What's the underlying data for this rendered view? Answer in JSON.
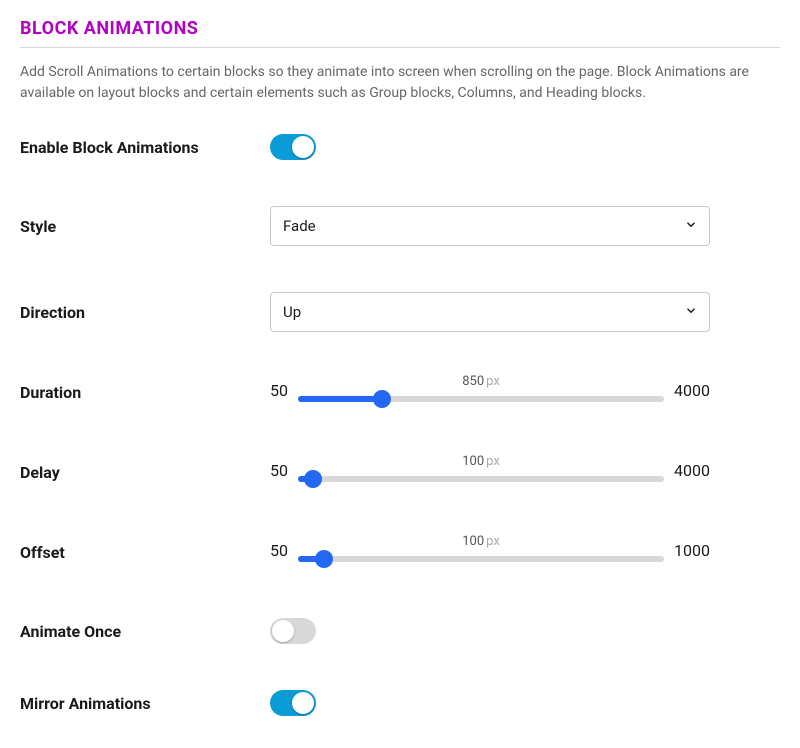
{
  "section": {
    "title": "BLOCK ANIMATIONS",
    "description": "Add Scroll Animations to certain blocks so they animate into screen when scrolling on the page. Block Animations are available on layout blocks and certain elements such as Group blocks, Columns, and Heading blocks."
  },
  "fields": {
    "enable": {
      "label": "Enable Block Animations",
      "value": true
    },
    "style": {
      "label": "Style",
      "value": "Fade"
    },
    "direction": {
      "label": "Direction",
      "value": "Up"
    },
    "duration": {
      "label": "Duration",
      "min": "50",
      "max": "4000",
      "value": "850",
      "unit": "px",
      "percent": 23
    },
    "delay": {
      "label": "Delay",
      "min": "50",
      "max": "4000",
      "value": "100",
      "unit": "px",
      "percent": 4
    },
    "offset": {
      "label": "Offset",
      "min": "50",
      "max": "1000",
      "value": "100",
      "unit": "px",
      "percent": 7
    },
    "animateOnce": {
      "label": "Animate Once",
      "value": false
    },
    "mirror": {
      "label": "Mirror Animations",
      "value": true
    }
  }
}
